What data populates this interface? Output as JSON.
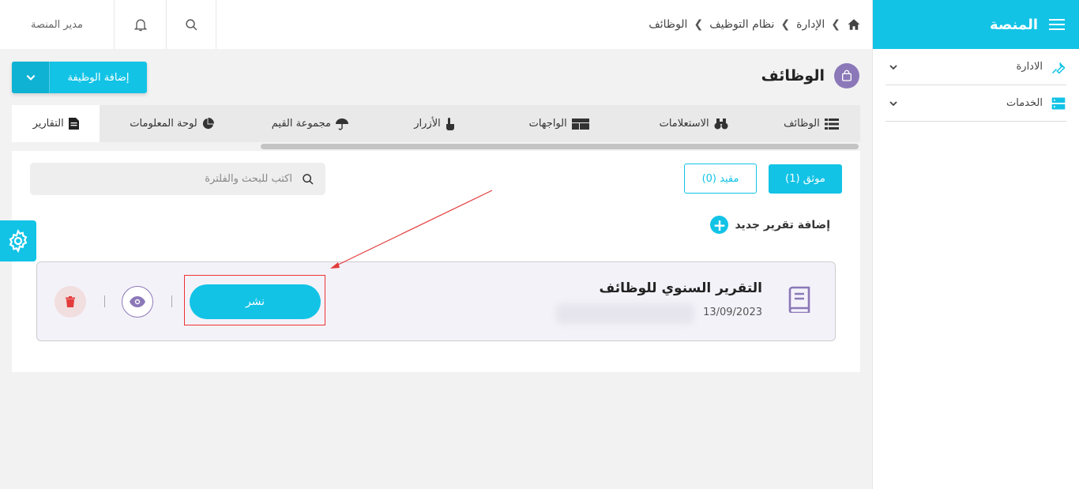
{
  "topbar": {
    "user_label": "مدير المنصة",
    "breadcrumb": [
      "الإدارة",
      "نظام التوظيف",
      "الوظائف"
    ]
  },
  "sidebar": {
    "title": "المنصة",
    "items": [
      {
        "label": "الادارة",
        "icon": "wrench-icon"
      },
      {
        "label": "الخدمات",
        "icon": "server-icon"
      }
    ]
  },
  "page": {
    "title": "الوظائف",
    "add_button": "إضافة الوظيفة"
  },
  "tabs": [
    {
      "label": "الوظائف",
      "icon": "list-icon"
    },
    {
      "label": "الاستعلامات",
      "icon": "binoculars-icon"
    },
    {
      "label": "الواجهات",
      "icon": "layout-icon"
    },
    {
      "label": "الأزرار",
      "icon": "pointer-icon"
    },
    {
      "label": "مجموعة القيم",
      "icon": "umbrella-icon"
    },
    {
      "label": "لوحة المعلومات",
      "icon": "pie-chart-icon"
    },
    {
      "label": "التقارير",
      "icon": "report-icon",
      "active": true
    }
  ],
  "filters": {
    "verified": "موثق (1)",
    "restricted": "مقيد (0)"
  },
  "search": {
    "placeholder": "اكتب للبحث والفلترة"
  },
  "add_report_label": "إضافة تقرير جديد",
  "report": {
    "title": "التقرير السنوي للوظائف",
    "date": "13/09/2023",
    "publish_label": "نشر"
  },
  "colors": {
    "accent": "#12c3e6",
    "purple": "#8b78b8",
    "danger": "#e33b3b"
  }
}
